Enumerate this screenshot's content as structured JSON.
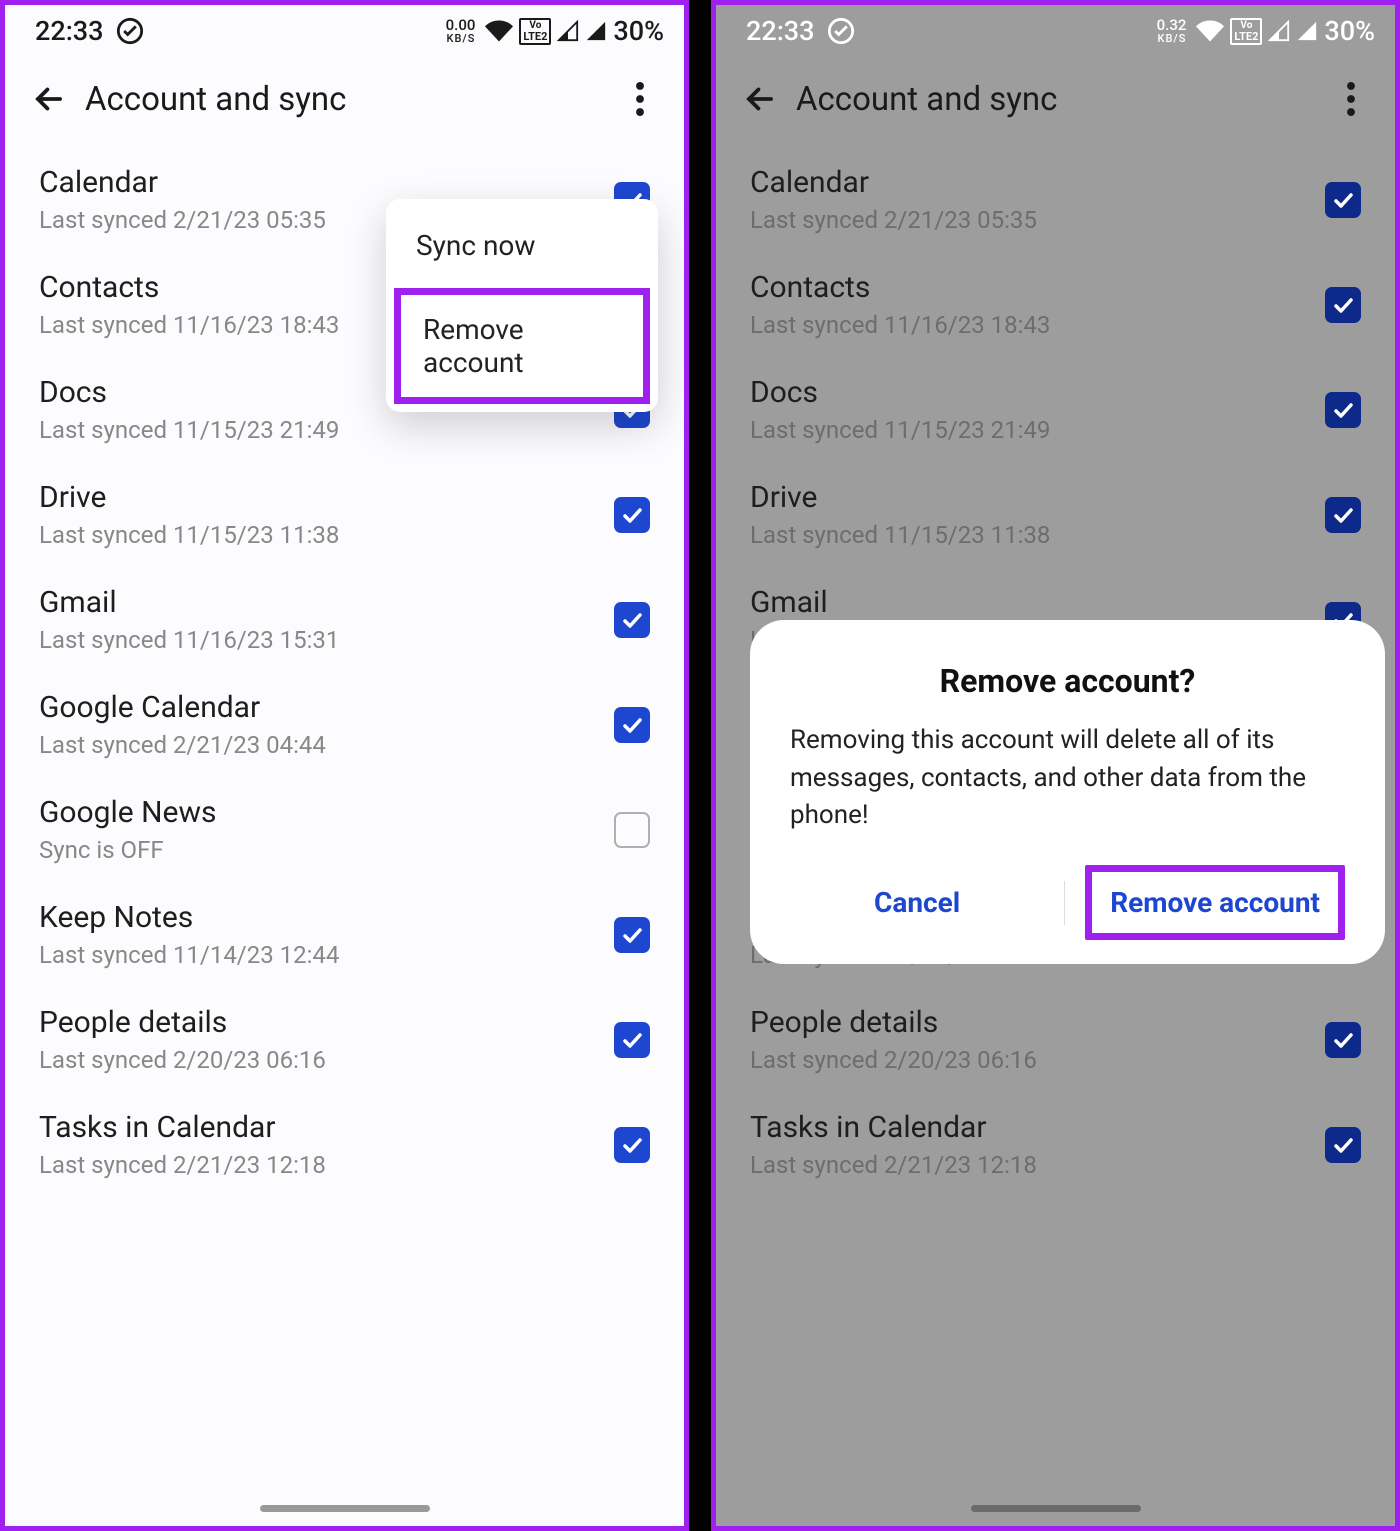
{
  "status": {
    "time": "22:33",
    "kbps_a": "0.00",
    "kbps_b": "0.32",
    "kbps_unit": "KB/S",
    "lte": "LTE2",
    "vo": "Vo",
    "battery": "30%"
  },
  "appbar": {
    "title": "Account and sync"
  },
  "sync_items": [
    {
      "title": "Calendar",
      "sub": "Last synced 2/21/23 05:35",
      "checked": true
    },
    {
      "title": "Contacts",
      "sub": "Last synced 11/16/23 18:43",
      "checked": true
    },
    {
      "title": "Docs",
      "sub": "Last synced 11/15/23 21:49",
      "checked": true
    },
    {
      "title": "Drive",
      "sub": "Last synced 11/15/23 11:38",
      "checked": true
    },
    {
      "title": "Gmail",
      "sub": "Last synced 11/16/23 15:31",
      "checked": true
    },
    {
      "title": "Google Calendar",
      "sub": "Last synced 2/21/23 04:44",
      "checked": true
    },
    {
      "title": "Google News",
      "sub": "Sync is OFF",
      "checked": false
    },
    {
      "title": "Keep Notes",
      "sub": "Last synced 11/14/23 12:44",
      "checked": true
    },
    {
      "title": "People details",
      "sub": "Last synced 2/20/23 06:16",
      "checked": true
    },
    {
      "title": "Tasks in Calendar",
      "sub": "Last synced 2/21/23 12:18",
      "checked": true
    }
  ],
  "popup": {
    "sync_now": "Sync now",
    "remove": "Remove account"
  },
  "dialog": {
    "title": "Remove account?",
    "message": "Removing this account will delete all of its messages, contacts, and other data from the phone!",
    "cancel": "Cancel",
    "confirm": "Remove account"
  },
  "colors": {
    "accent": "#1e47d1",
    "highlight": "#a020f0"
  }
}
